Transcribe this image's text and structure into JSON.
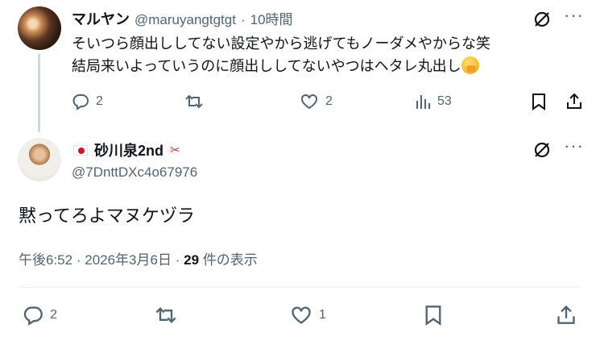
{
  "tweet1": {
    "name": "マルヤン",
    "handle": "@maruyangtgtgt",
    "separator": "·",
    "time": "10時間",
    "text_line1": "そいつら顔出ししてない設定やから逃げてもノーダメやからな笑",
    "text_line2": "結局来いよっていうのに顔出ししてないやつはヘタレ丸出し",
    "emoji": "hand-over-mouth-emoji",
    "replies": "2",
    "likes": "2",
    "views": "53",
    "more": "···"
  },
  "tweet2": {
    "flag": "japan-flag",
    "name": "砂川泉2nd",
    "handle": "@7DnttDXc4o67976",
    "text": "黙ってろよマヌケヅラ",
    "time": "午後6:52",
    "separator": "·",
    "date": "2026年3月6日",
    "separator2": "·",
    "views_count": "29",
    "views_label": " 件の表示",
    "replies": "2",
    "likes": "1",
    "more": "···"
  },
  "icons": {
    "reply": "reply-icon",
    "retweet": "retweet-icon",
    "like": "heart-icon",
    "views": "views-icon",
    "bookmark": "bookmark-icon",
    "share": "share-icon",
    "grok": "grok-icon"
  },
  "colors": {
    "text": "#0f1419",
    "secondary": "#536471",
    "thread_line": "#cfd9de"
  }
}
